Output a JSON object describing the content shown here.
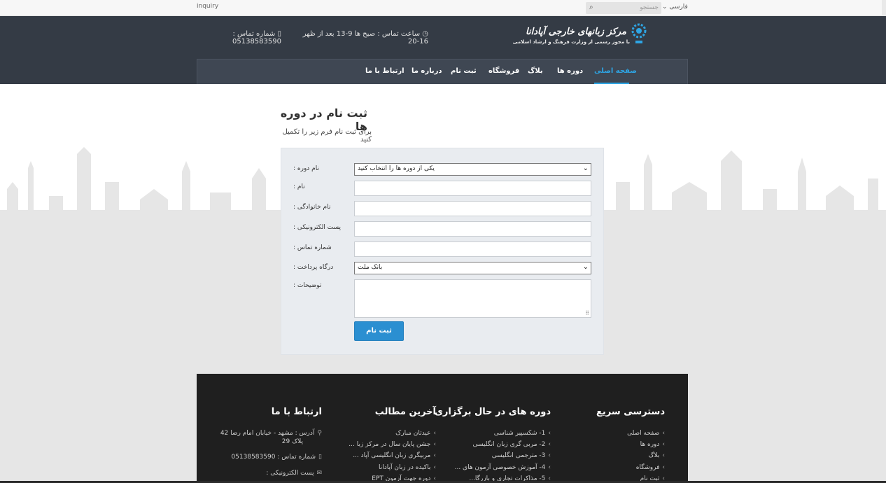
{
  "topbar": {
    "inquiry": "inquiry",
    "search_placeholder": "جستجو",
    "search_icon": "search-icon",
    "language": "فارسی"
  },
  "header": {
    "logo_title": "مرکز زبانهای خارجی آپادانا",
    "logo_subtitle": "با مجوز رسمی از وزارت فرهنگ و ارشاد اسلامی",
    "hours": "ساعت تماس : صبح ها 9-13 بعد از ظهر 16-20",
    "phone": "شماره تماس : 05138583590",
    "nav": [
      {
        "label": "صفحه اصلی",
        "active": true
      },
      {
        "label": "دوره ها"
      },
      {
        "label": "بلاگ"
      },
      {
        "label": "فروشگاه"
      },
      {
        "label": "ثبت نام"
      },
      {
        "label": "درباره ما"
      },
      {
        "label": "ارتباط با ما"
      }
    ],
    "accent_color": "#2ea5e4"
  },
  "main": {
    "title": "ثبت نام در دوره ها",
    "subtitle": "برای ثبت نام فرم زیر را تکمیل کنید",
    "form": {
      "course_label": "نام دوره :",
      "course_value": "یکی از دوره ها را انتخاب کنید",
      "name_label": "نام :",
      "family_label": "نام خانوادگی :",
      "email_label": "پست الکترونیکی :",
      "phone_label": "شماره تماس :",
      "gateway_label": "درگاه پرداخت :",
      "gateway_value": "بانک ملت",
      "notes_label": "توضیحات :",
      "submit_label": "ثبت نام",
      "submit_color": "#2b8fd1"
    }
  },
  "footer": {
    "quick_access": {
      "title": "دسترسی سریع",
      "items": [
        "صفحه اصلی",
        "دوره ها",
        "بلاگ",
        "فروشگاه",
        "ثبت نام"
      ]
    },
    "courses": {
      "title": "دوره های در حال برگزاری",
      "items": [
        "1- شکسپیر شناسی",
        "2- مربی گری زبان انگلیسی",
        "3- مترجمی انگلیسی",
        "4- آموزش خصوصی آزمون های ...",
        "5- مذاکرات تجاری و بازرگا..."
      ]
    },
    "latest_posts": {
      "title": "آخرین مطالب",
      "items": [
        "عیدتان مبارک",
        "جشن پایان سال در مرکز زبا ...",
        "مربیگری زبان انگلیسی آپاد ...",
        "باکیده در زبان آپادانا",
        "دوره جهت آزمون EPT"
      ]
    },
    "contact": {
      "title": "ارتباط با ما",
      "address_line1": "آدرس : مشهد - خیابان امام رضا 42",
      "address_line2": "پلاک 29",
      "phone": "شماره تماس : 05138583590",
      "email_label": "پست الکترونیکی :"
    }
  }
}
